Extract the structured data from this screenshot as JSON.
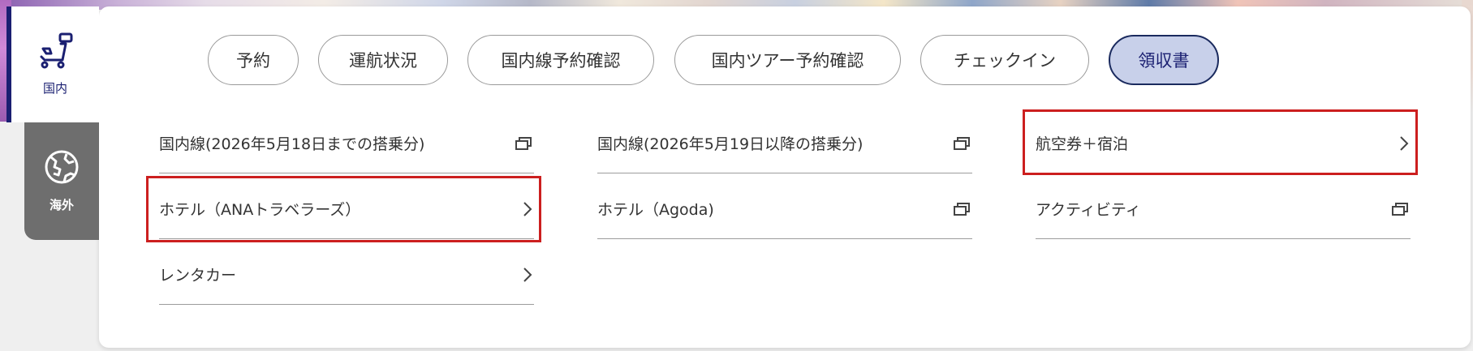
{
  "categories": [
    {
      "label": "国内",
      "icon": "airline-seat-icon"
    },
    {
      "label": "海外",
      "icon": "globe-icon"
    }
  ],
  "nav": {
    "pills": [
      {
        "label": "予約"
      },
      {
        "label": "運航状況"
      },
      {
        "label": "国内線予約確認"
      },
      {
        "label": "国内ツアー予約確認"
      },
      {
        "label": "チェックイン"
      },
      {
        "label": "領収書",
        "active": true
      }
    ]
  },
  "menu": {
    "col1": [
      {
        "label": "国内線(2026年5月18日までの搭乗分)",
        "icon": "external-window-icon"
      },
      {
        "label": "ホテル（ANAトラベラーズ）",
        "icon": "chevron-right-icon",
        "highlighted": true
      },
      {
        "label": "レンタカー",
        "icon": "chevron-right-icon"
      }
    ],
    "col2": [
      {
        "label": "国内線(2026年5月19日以降の搭乗分)",
        "icon": "external-window-icon"
      },
      {
        "label": "ホテル（Agoda)",
        "icon": "external-window-icon"
      }
    ],
    "col3": [
      {
        "label": "航空券＋宿泊",
        "icon": "chevron-right-icon",
        "highlighted": true
      },
      {
        "label": "アクティビティ",
        "icon": "external-window-icon"
      }
    ]
  },
  "colors": {
    "brand_navy": "#1a1f71",
    "active_pill_bg": "#c8d0ea",
    "highlight_red": "#cc1f1f"
  }
}
